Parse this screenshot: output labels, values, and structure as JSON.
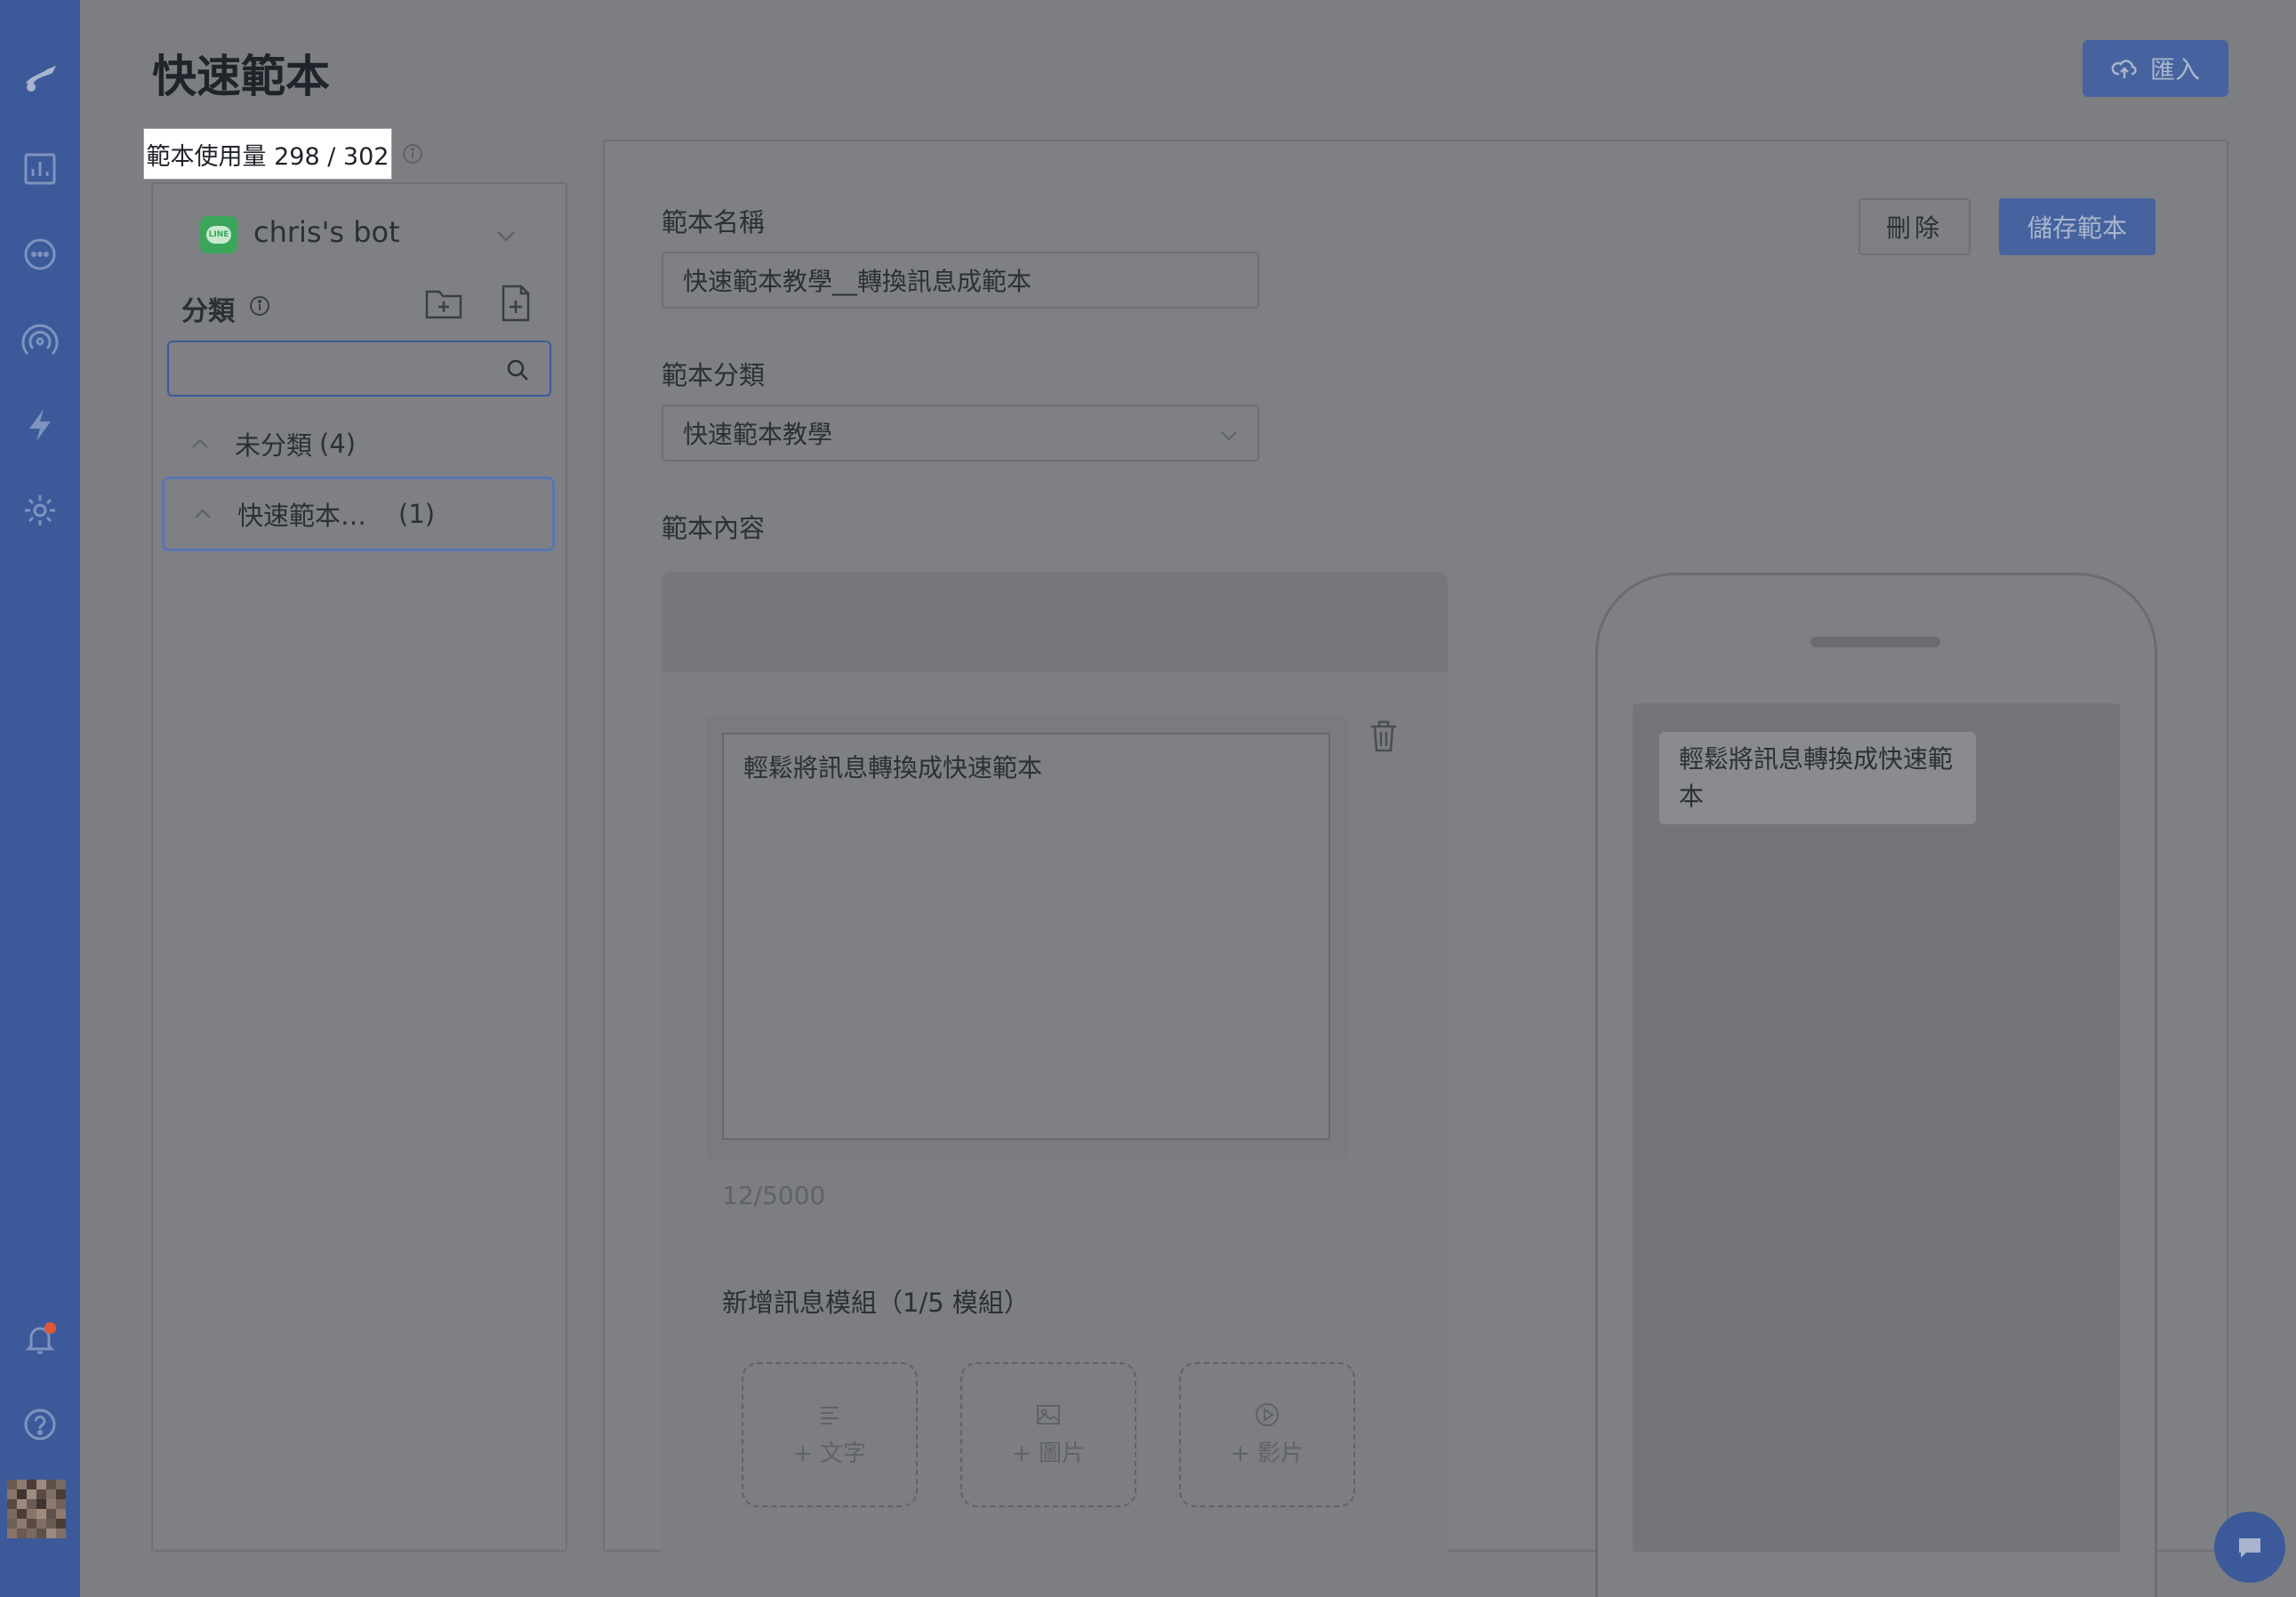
{
  "page": {
    "title": "快速範本",
    "import_label": "匯入"
  },
  "usage": {
    "text": "範本使用量 298 / 302"
  },
  "sidebar": {
    "bot_name": "chris's bot",
    "bot_badge": "LINE",
    "category_label": "分類",
    "search_placeholder": "",
    "categories": [
      {
        "name": "未分類",
        "count": "(4)"
      },
      {
        "name": "快速範本…",
        "count": "(1)"
      }
    ]
  },
  "editor": {
    "name_label": "範本名稱",
    "name_value": "快速範本教學__轉換訊息成範本",
    "category_label": "範本分類",
    "category_value": "快速範本教學",
    "content_label": "範本內容",
    "delete_label": "刪除",
    "save_label": "儲存範本",
    "message_text": "輕鬆將訊息轉換成快速範本",
    "counter": "12/5000",
    "add_module_label": "新增訊息模組（1/5 模組）",
    "modules": [
      {
        "label": "+ 文字",
        "icon": "text-icon"
      },
      {
        "label": "+ 圖片",
        "icon": "image-icon"
      },
      {
        "label": "+ 影片",
        "icon": "video-icon"
      }
    ]
  },
  "preview": {
    "bubble_text": "輕鬆將訊息轉換成快速範本"
  },
  "colors": {
    "rail": "#3c5a9a",
    "primary_button": "#46639f",
    "overlay_bg": "#7d7e82"
  }
}
